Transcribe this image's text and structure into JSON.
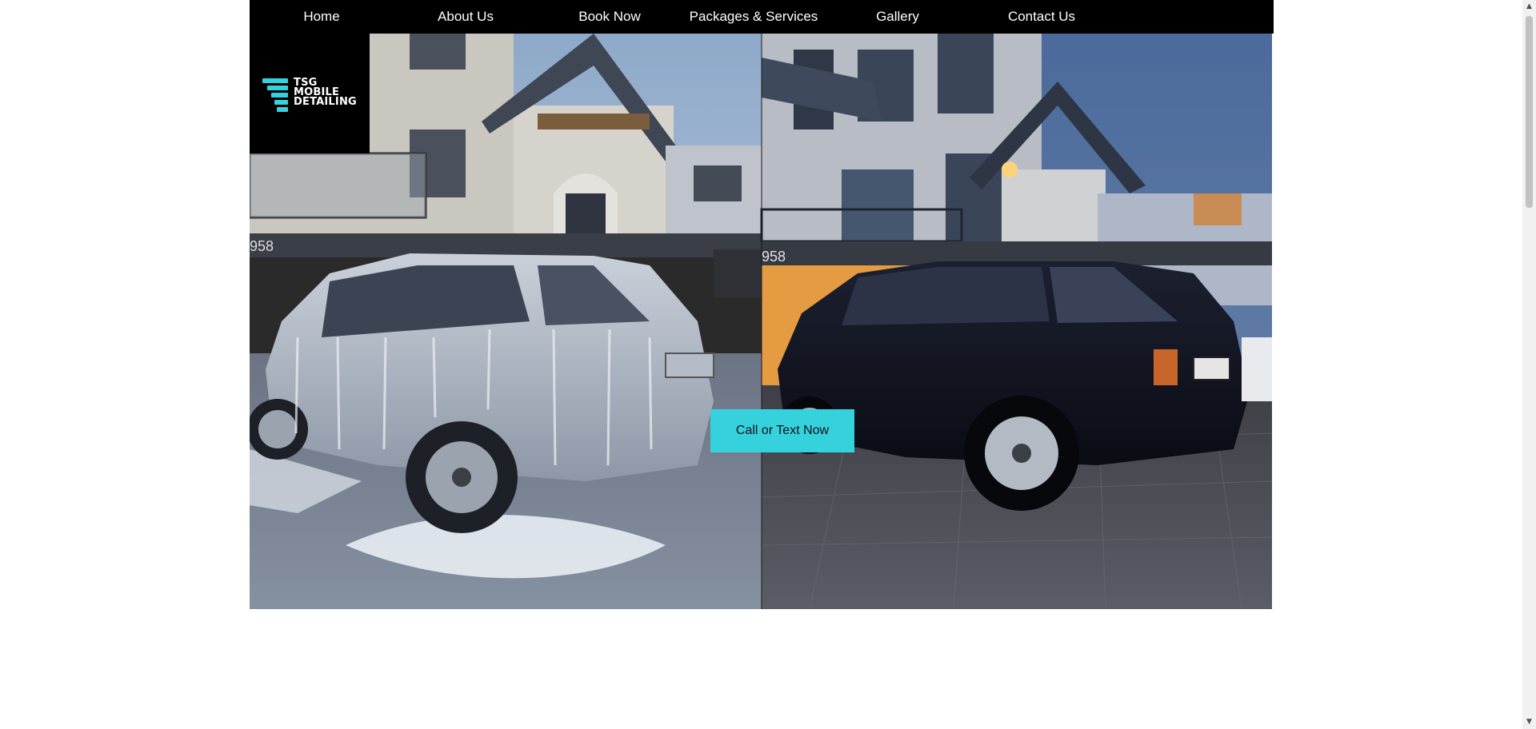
{
  "nav": {
    "items": [
      {
        "label": "Home"
      },
      {
        "label": "About Us"
      },
      {
        "label": "Book Now"
      },
      {
        "label": "Packages & Services"
      },
      {
        "label": "Gallery"
      },
      {
        "label": "Contact Us"
      }
    ]
  },
  "logo": {
    "line1": "TSG",
    "line2": "MOBILE",
    "line3": "DETAILING"
  },
  "hero": {
    "cta_label": "Call or Text Now",
    "image_left": "Range Rover covered in snow foam in front of a house",
    "image_right": "Clean black Range Rover in front of a house at dusk"
  },
  "colors": {
    "nav_bg": "#000000",
    "accent": "#35d2de",
    "page_bg": "#ffffff"
  },
  "icons": {
    "logo_mark": "stacked-stripes-logo-icon",
    "scroll_up": "triangle-up-icon",
    "scroll_down": "triangle-down-icon"
  }
}
